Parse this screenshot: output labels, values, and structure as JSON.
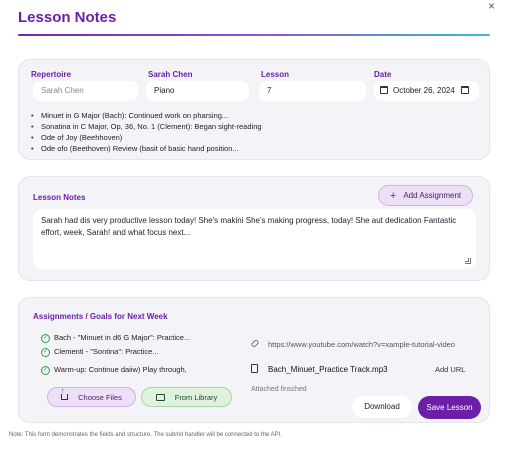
{
  "modal": {
    "title": "Lesson Notes",
    "close_glyph": "×"
  },
  "info": {
    "repertoire_label": "Repertoire",
    "repertoire_placeholder": "Sarah Chen",
    "student_label": "Sarah Chen",
    "student_value": "Piano",
    "lesson_label": "Lesson",
    "lesson_value": "7",
    "date_label": "Date",
    "date_value": "October 26, 2024",
    "repertoire_items": [
      "Minuet in G Major (Bach): Continued work on pharsing...",
      "Sonatina in C Major, Op, 36, No. 1 (Clement): Began sight-reading",
      "Ode of Joy (Beehhoven)",
      "Ode ofo (Beethoven) Review (basit of basic hand position..."
    ]
  },
  "notes": {
    "title": "Lesson Notes",
    "add_label": "Add Assignment",
    "text": "Sarah had dis very productive lesson today! She's makini She's making progress, today! She aut dedication Fantastic effort, week, Sarah! and what focus next..."
  },
  "assignments": {
    "title": "Assignments / Goals for Next Week",
    "items": [
      "Bach - \"Minuet in d6 G Major\": Practice...",
      "Clementi - \"Sontina\": Practice...",
      "Warm-up: Continue daiiw) Play through,"
    ],
    "url_value": "https://www.youtube.com/watch?v=xample-tutorial-video",
    "file_name": "Bach_Minuet_Practice Track.mp3",
    "add_url_label": "Add URL",
    "attached_text": "Attached finsched",
    "choose_files_label": "Choose Files",
    "from_library_label": "From Library"
  },
  "actions": {
    "download_label": "Download",
    "save_label": "Save Lesson"
  },
  "footnote": "Note: This form demonstrates the fields and structure. The submit handler will be connected to the API.",
  "colors": {
    "accent": "#6b1fa8",
    "success": "#2aa34a",
    "card_bg": "#f4f3f7"
  }
}
